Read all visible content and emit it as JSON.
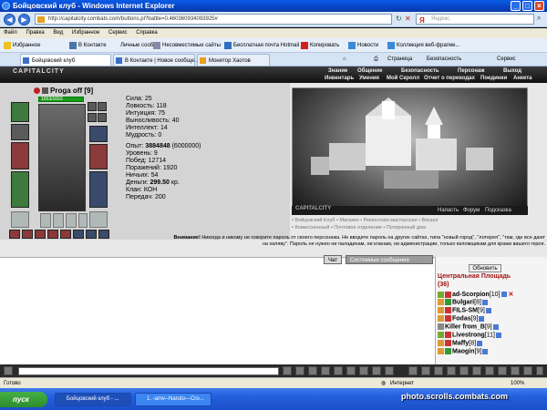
{
  "window": {
    "title": "Бойцовский клуб - Windows Internet Explorer"
  },
  "address": {
    "url": "http://capitalcity.combats.com/buttons.pl?battle=0.460360934093925#",
    "search_placeholder": "Яндекс"
  },
  "menu": [
    "Файл",
    "Правка",
    "Вид",
    "Избранное",
    "Сервис",
    "Справка"
  ],
  "favorites": {
    "label": "Избранное",
    "items": [
      "В Контакте",
      "Личные сооб...",
      "Несовместимые сайты",
      "Бесплатная почта Hotmail",
      "Копировать",
      "Новости",
      "Коллекция веб-фрагме..."
    ]
  },
  "tabs": [
    "Бойцовский клуб",
    "В Контакте | Новое сообще...",
    "Монитор Хаотов"
  ],
  "command_bar": [
    "Страница",
    "Безопасность",
    "Сервис"
  ],
  "game": {
    "logo": "CAPITALCITY",
    "nav_top": [
      "Знание",
      "Общение",
      "Безопасность",
      "Персонаж",
      "Выход"
    ],
    "nav_bottom": [
      "Инвентарь",
      "Умения",
      "Мой Скролл",
      "Отчет о переводах",
      "Поединки",
      "Анкета"
    ],
    "character": {
      "name": "Proga off",
      "level": "[9]",
      "hp": "1653/1653",
      "stats": [
        {
          "label": "Сила:",
          "value": "25"
        },
        {
          "label": "Ловкость:",
          "value": "118"
        },
        {
          "label": "Интуиция:",
          "value": "75"
        },
        {
          "label": "Выносливость:",
          "value": "40"
        },
        {
          "label": "Интеллект:",
          "value": "14"
        },
        {
          "label": "Мудрость:",
          "value": "0"
        }
      ],
      "info": [
        {
          "label": "Опыт:",
          "value": "3884848",
          "extra": "(6000000)"
        },
        {
          "label": "Уровень:",
          "value": "9"
        },
        {
          "label": "Побед:",
          "value": "12714"
        },
        {
          "label": "Поражений:",
          "value": "1920"
        },
        {
          "label": "Ничьих:",
          "value": "54"
        },
        {
          "label": "Деньги:",
          "value": "299.50",
          "extra": "кр."
        },
        {
          "label": "Клан:",
          "value": "КОН"
        },
        {
          "label": "Передач:",
          "value": "200"
        }
      ]
    },
    "scene": {
      "label": "CAPITALCITY",
      "links": [
        "Напасть",
        "Форум",
        "Подсказка"
      ],
      "sublinks_1": "• Бойцовский Клуб  • Магазин  • Ремонтная мастерская  • Вокзал",
      "sublinks_2": "• Комиссионный  • Почтовое отделение  • Потерянный дом"
    },
    "warning": {
      "strong": "Внимание!",
      "text": "Никогда и никому не говорите пароль от своего персонажа. Не вводите пароль на других сайтах, типа \"новый город\", \"лотерея\", \"там, где все дают на халяву\". Пароль не нужен ни паладинам, ни кланам, ни администрации, только взломщикам для кражи вашего героя."
    },
    "chat_tabs": [
      "Чат",
      "Системные сообщения"
    ],
    "location": {
      "refresh": "Обновить",
      "name": "Центральная Площадь",
      "count": "(36)",
      "players": [
        {
          "name": "ad-Scorpion",
          "level": "[10]"
        },
        {
          "name": "Bulgari",
          "level": "[8]"
        },
        {
          "name": "FILS-SM",
          "level": "[9]"
        },
        {
          "name": "Fodas",
          "level": "[9]"
        },
        {
          "name": "Killer from_B",
          "level": "[9]"
        },
        {
          "name": "Livestrong",
          "level": "[11]"
        },
        {
          "name": "Maffy",
          "level": "[8]"
        },
        {
          "name": "Maogin",
          "level": "[9]"
        }
      ]
    }
  },
  "status": {
    "left": "Готово",
    "zone": "Интернет",
    "zoom": "100%"
  },
  "taskbar": {
    "start": "пуск",
    "buttons": [
      "Бойцовский клуб - ...",
      "1. -amv--Naruto---Cro..."
    ],
    "watermark": "photo.scrolls.combats.com"
  },
  "colors": {
    "title_blue": "#0a5be8",
    "hp_green": "#1a9a1a",
    "location_red": "#a01010"
  }
}
